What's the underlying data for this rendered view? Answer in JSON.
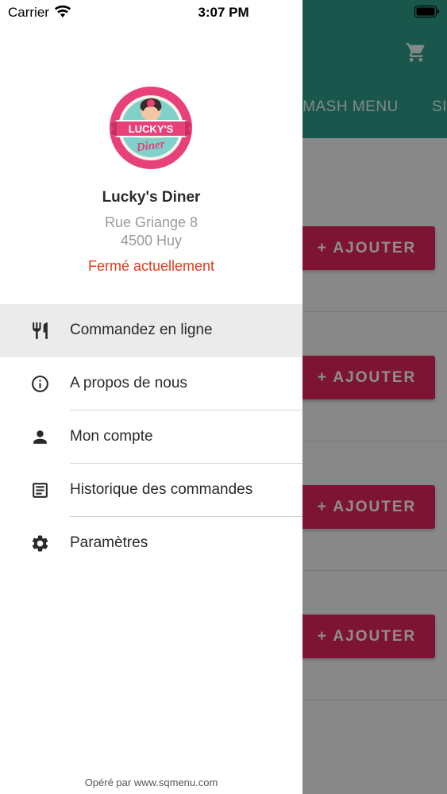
{
  "status_bar": {
    "carrier": "Carrier",
    "time": "3:07 PM"
  },
  "background": {
    "categories": [
      "SMASH MENU",
      "SI"
    ],
    "add_button_label": "+ AJOUTER",
    "header_color": "#2e9a86",
    "accent_color": "#e0245e"
  },
  "drawer": {
    "logo_text": "LUCKY'S Diner",
    "restaurant_name": "Lucky's Diner",
    "address_line1": "Rue Griange 8",
    "address_line2": "4500 Huy",
    "status": "Fermé actuellement",
    "status_color": "#e53a1b",
    "nav_items": [
      {
        "label": "Commandez en ligne",
        "icon": "restaurant-icon",
        "active": true
      },
      {
        "label": "A propos de nous",
        "icon": "info-icon",
        "active": false
      },
      {
        "label": "Mon compte",
        "icon": "person-icon",
        "active": false
      },
      {
        "label": "Historique des commandes",
        "icon": "receipt-icon",
        "active": false
      },
      {
        "label": "Paramètres",
        "icon": "gear-icon",
        "active": false
      }
    ],
    "footer": "Opéré par  www.sqmenu.com"
  }
}
